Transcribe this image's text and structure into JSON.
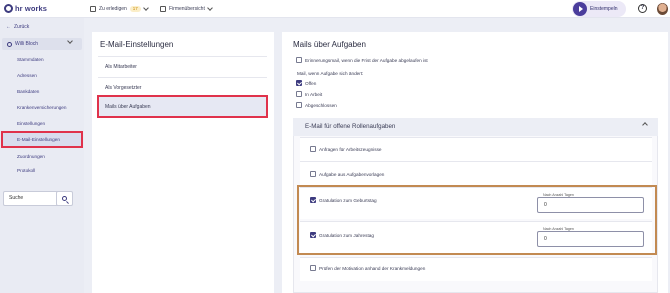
{
  "topbar": {
    "brand": "hr works",
    "todo_label": "Zu erledigen",
    "todo_count": "17",
    "overview_label": "Firmenübersicht",
    "stamp_label": "Einstempeln",
    "help": "?"
  },
  "sidebar": {
    "back_label": "Zurück",
    "person_name": "Willi Bloch",
    "items": [
      {
        "label": "Stammdaten"
      },
      {
        "label": "Adressen"
      },
      {
        "label": "Bankdaten"
      },
      {
        "label": "Krankenversicherungen"
      },
      {
        "label": "Einstellungen"
      },
      {
        "label": "E-Mail-Einstellungen"
      },
      {
        "label": "Zuordnungen"
      },
      {
        "label": "Protokoll"
      }
    ],
    "search_value": "Suche"
  },
  "middle": {
    "title": "E-Mail-Einstellungen",
    "items": [
      {
        "label": "Als Mitarbeiter"
      },
      {
        "label": "Als Vorgesetzter"
      },
      {
        "label": "Mails über Aufgaben"
      }
    ]
  },
  "right": {
    "title": "Mails über Aufgaben",
    "reminder_label": "Erinnerungsmail, wenn die Frist der Aufgabe abgelaufen ist",
    "status_label": "Mail, wenn Aufgabe sich ändert:",
    "status_options": [
      {
        "label": "Offen",
        "checked": true
      },
      {
        "label": "In Arbeit",
        "checked": false
      },
      {
        "label": "Abgeschlossen",
        "checked": false
      }
    ],
    "section_title": "E-Mail für offene Rollenaufgaben",
    "section_items": [
      {
        "label": "Anfragen für Arbeitszeugnisse",
        "checked": false
      },
      {
        "label": "Aufgabe aus Aufgabenvorlagen",
        "checked": false
      },
      {
        "label": "Gratulation zum Geburtstag",
        "checked": true,
        "field_label": "Nach Anzahl Tagen",
        "field_value": "0"
      },
      {
        "label": "Gratulation zum Jahrestag",
        "checked": true,
        "field_label": "Nach Anzahl Tagen",
        "field_value": "0"
      },
      {
        "label": "Prüfen der Motivation anhand der Krankmeldungen",
        "checked": false
      }
    ]
  },
  "colors": {
    "accent": "#3d3b7f",
    "highlight_red": "#e0324b",
    "highlight_orange": "#c28a52"
  }
}
